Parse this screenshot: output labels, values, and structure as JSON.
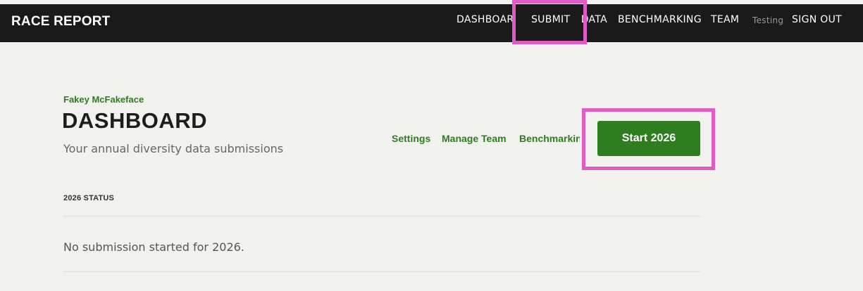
{
  "app": {
    "brand": "RACE REPORT"
  },
  "nav": {
    "items": [
      {
        "label": "DASHBOARD",
        "active": true
      },
      {
        "label": "SUBMIT"
      },
      {
        "label": "DATA"
      },
      {
        "label": "BENCHMARKING"
      },
      {
        "label": "TEAM"
      },
      {
        "label": "Testing",
        "muted": true
      },
      {
        "label": "SIGN OUT"
      }
    ]
  },
  "header": {
    "user_name": "Fakey McFakeface",
    "title": "DASHBOARD",
    "subtitle": "Your annual diversity data submissions"
  },
  "links": [
    "Settings",
    "Manage Team",
    "Benchmarking"
  ],
  "actions": {
    "start_button": "Start 2026"
  },
  "status": {
    "label": "2026 STATUS",
    "message": "No submission started for 2026."
  },
  "colors": {
    "nav_background": "#1a1a1a",
    "page_background": "#f1f1ee",
    "accent_green": "#2e7d1f",
    "highlight_magenta": "#e05bc6"
  }
}
